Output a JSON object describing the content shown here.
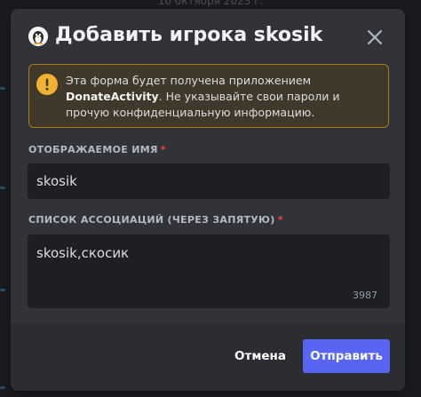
{
  "background": {
    "date_label": "10 октября 2023 г."
  },
  "modal": {
    "title": "Добавить игрока skosik",
    "app_icon": "app-avatar-icon",
    "close_icon": "close-icon"
  },
  "warning": {
    "icon": "warning-icon",
    "text_before": "Эта форма будет получена приложением ",
    "app_name": "DonateActivity",
    "text_after": ". Не указывайте свои пароли и прочую конфиденциальную информацию."
  },
  "fields": {
    "display_name": {
      "label": "ОТОБРАЖАЕМОЕ ИМЯ",
      "required_mark": "*",
      "value": "skosik"
    },
    "associations": {
      "label": "СПИСОК АССОЦИАЦИЙ (ЧЕРЕЗ ЗАПЯТУЮ)",
      "required_mark": "*",
      "value": "skosik,скосик",
      "remaining_chars": "3987"
    }
  },
  "footer": {
    "cancel_label": "Отмена",
    "submit_label": "Отправить"
  },
  "colors": {
    "accent": "#5865f2",
    "warning_border": "#a67c1f",
    "warning_icon": "#f0b232",
    "required": "#f23f42",
    "modal_bg": "#313338",
    "footer_bg": "#2b2d31",
    "input_bg": "#1e1f22"
  }
}
